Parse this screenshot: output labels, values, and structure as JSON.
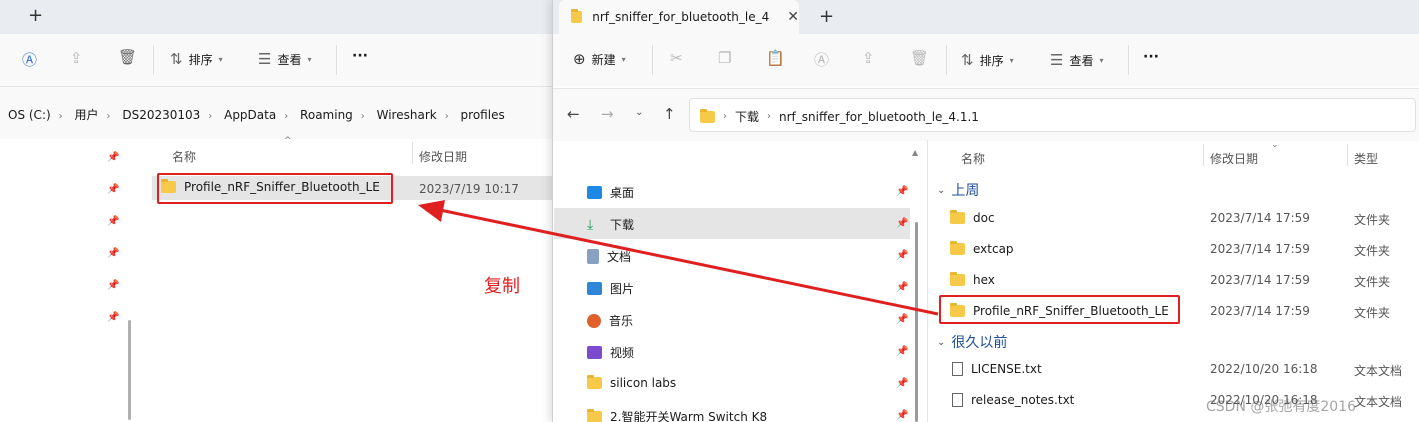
{
  "left": {
    "toolbar": {
      "sort_label": "排序",
      "view_label": "查看",
      "more_label": "···"
    },
    "breadcrumb": [
      "OS (C:)",
      "用户",
      "DS20230103",
      "AppData",
      "Roaming",
      "Wireshark",
      "profiles"
    ],
    "columns": {
      "name": "名称",
      "date": "修改日期"
    },
    "rows": [
      {
        "name": "Profile_nRF_Sniffer_Bluetooth_LE",
        "date": "2023/7/19 10:17"
      }
    ]
  },
  "right": {
    "tab_title": "nrf_sniffer_for_bluetooth_le_4",
    "toolbar": {
      "new_label": "新建",
      "sort_label": "排序",
      "view_label": "查看",
      "more_label": "···"
    },
    "breadcrumb": [
      "下载",
      "nrf_sniffer_for_bluetooth_le_4.1.1"
    ],
    "nav": [
      {
        "label": "桌面",
        "icon": "desktop-icon",
        "color": "#1e88e5"
      },
      {
        "label": "下载",
        "icon": "download-icon",
        "color": "#1e9e57"
      },
      {
        "label": "文档",
        "icon": "documents-icon",
        "color": "#8aa0c0"
      },
      {
        "label": "图片",
        "icon": "pictures-icon",
        "color": "#2f86d8"
      },
      {
        "label": "音乐",
        "icon": "music-icon",
        "color": "#e0602c"
      },
      {
        "label": "视频",
        "icon": "videos-icon",
        "color": "#7b4bd0"
      },
      {
        "label": "silicon labs",
        "icon": "folder-icon",
        "color": "#f7c948"
      },
      {
        "label": "2.智能开关Warm Switch K8",
        "icon": "folder-icon",
        "color": "#f7c948"
      }
    ],
    "columns": {
      "name": "名称",
      "date": "修改日期",
      "type": "类型"
    },
    "groups": {
      "last_week": "上周",
      "long_ago": "很久以前"
    },
    "rows_last_week": [
      {
        "name": "doc",
        "date": "2023/7/14 17:59",
        "type": "文件夹"
      },
      {
        "name": "extcap",
        "date": "2023/7/14 17:59",
        "type": "文件夹"
      },
      {
        "name": "hex",
        "date": "2023/7/14 17:59",
        "type": "文件夹"
      },
      {
        "name": "Profile_nRF_Sniffer_Bluetooth_LE",
        "date": "2023/7/14 17:59",
        "type": "文件夹"
      }
    ],
    "rows_long_ago": [
      {
        "name": "LICENSE.txt",
        "date": "2022/10/20 16:18",
        "type": "文本文档"
      },
      {
        "name": "release_notes.txt",
        "date": "2022/10/20 16:18",
        "type": "文本文档"
      }
    ]
  },
  "annotation": {
    "label": "复制",
    "color": "#e02020"
  },
  "watermark": "CSDN @张弛有度2016"
}
